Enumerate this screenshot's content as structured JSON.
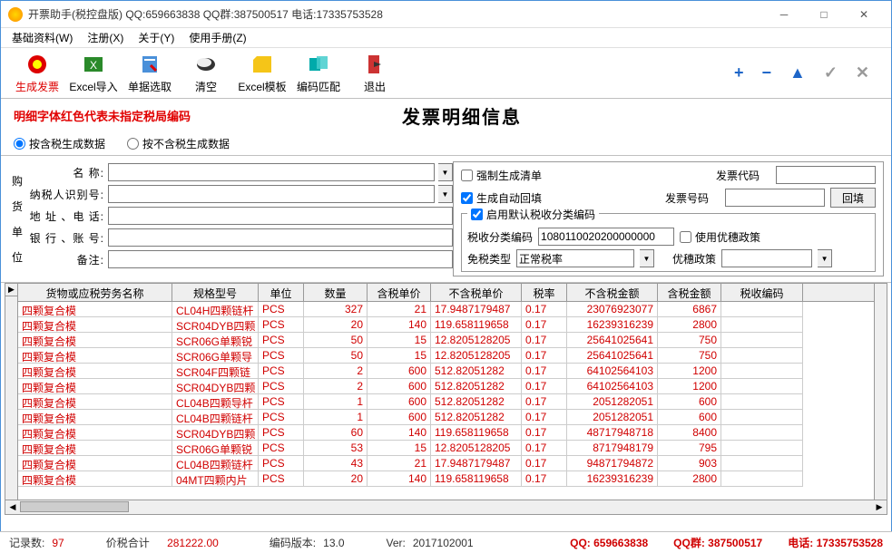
{
  "title": "开票助手(税控盘版)   QQ:659663838   QQ群:387500517   电话:17335753528",
  "menu": [
    "基础资料(W)",
    "注册(X)",
    "关于(Y)",
    "使用手册(Z)"
  ],
  "toolbar": [
    {
      "label": "生成发票",
      "color": "#d00"
    },
    {
      "label": "Excel导入",
      "color": "#090"
    },
    {
      "label": "单据选取",
      "color": "#06c"
    },
    {
      "label": "清空",
      "color": "#333"
    },
    {
      "label": "Excel模板",
      "color": "#e90"
    },
    {
      "label": "编码匹配",
      "color": "#099"
    },
    {
      "label": "退出",
      "color": "#c33"
    }
  ],
  "tb_right_colors": {
    "plus": "#1e66c8",
    "minus": "#1e66c8",
    "up": "#1e66c8",
    "check": "#8a8a8a",
    "x": "#8a8a8a"
  },
  "red_note": "明细字体红色代表未指定税局编码",
  "main_title": "发票明细信息",
  "radio": {
    "r1": "按含税生成数据",
    "r2": "按不含税生成数据"
  },
  "vlabel": [
    "购",
    "货",
    "单",
    "位"
  ],
  "form": {
    "name": "名          称:",
    "taxid": "纳税人识别号:",
    "addr": "地 址 、电 话:",
    "bank": "银 行 、账 号:",
    "remark": "备注:"
  },
  "fr": {
    "force": "强制生成清单",
    "autofill": "生成自动回填",
    "code_lbl": "发票代码",
    "num_lbl": "发票号码",
    "backfill_btn": "回填",
    "group_title": "启用默认税收分类编码",
    "taxclass_lbl": "税收分类编码",
    "taxclass_val": "1080110020200000000",
    "pref_lbl": "使用优穗政策",
    "exempt_lbl": "免税类型",
    "exempt_val": "正常税率",
    "pref2_lbl": "优穗政策"
  },
  "grid_headers": [
    "货物或应税劳务名称",
    "规格型号",
    "单位",
    "数量",
    "含税单价",
    "不含税单价",
    "税率",
    "不含税金额",
    "含税金额",
    "税收编码"
  ],
  "grid_rows": [
    [
      "四颗复合模",
      "CL04H四颗链杆",
      "PCS",
      "327",
      "21",
      "17.9487179487",
      "0.17",
      "23076923077",
      "6867",
      ""
    ],
    [
      "四颗复合模",
      "SCR04DYB四颗",
      "PCS",
      "20",
      "140",
      "119.658119658",
      "0.17",
      "16239316239",
      "2800",
      ""
    ],
    [
      "四颗复合模",
      "SCR06G单颗锐",
      "PCS",
      "50",
      "15",
      "12.8205128205",
      "0.17",
      "25641025641",
      "750",
      ""
    ],
    [
      "四颗复合模",
      "SCR06G单颗导",
      "PCS",
      "50",
      "15",
      "12.8205128205",
      "0.17",
      "25641025641",
      "750",
      ""
    ],
    [
      "四颗复合模",
      "SCR04F四颗链",
      "PCS",
      "2",
      "600",
      "512.82051282",
      "0.17",
      "64102564103",
      "1200",
      ""
    ],
    [
      "四颗复合模",
      "SCR04DYB四颗",
      "PCS",
      "2",
      "600",
      "512.82051282",
      "0.17",
      "64102564103",
      "1200",
      ""
    ],
    [
      "四颗复合模",
      "CL04B四颗导杆",
      "PCS",
      "1",
      "600",
      "512.82051282",
      "0.17",
      "2051282051",
      "600",
      ""
    ],
    [
      "四颗复合模",
      "CL04B四颗链杆",
      "PCS",
      "1",
      "600",
      "512.82051282",
      "0.17",
      "2051282051",
      "600",
      ""
    ],
    [
      "四颗复合模",
      "SCR04DYB四颗",
      "PCS",
      "60",
      "140",
      "119.658119658",
      "0.17",
      "48717948718",
      "8400",
      ""
    ],
    [
      "四颗复合模",
      "SCR06G单颗锐",
      "PCS",
      "53",
      "15",
      "12.8205128205",
      "0.17",
      "8717948179",
      "795",
      ""
    ],
    [
      "四颗复合模",
      "CL04B四颗链杆",
      "PCS",
      "43",
      "21",
      "17.9487179487",
      "0.17",
      "94871794872",
      "903",
      ""
    ],
    [
      "四颗复合模",
      "04MT四颗内片",
      "PCS",
      "20",
      "140",
      "119.658119658",
      "0.17",
      "16239316239",
      "2800",
      ""
    ]
  ],
  "status": {
    "rec_lbl": "记录数:",
    "rec_val": "97",
    "total_lbl": "价税合计",
    "total_val": "281222.00",
    "enc_lbl": "编码版本:",
    "enc_val": "13.0",
    "ver_lbl": "Ver:",
    "ver_val": "2017102001",
    "qq": "QQ: 659663838",
    "qqg": "QQ群: 387500517",
    "tel": "电话: 17335753528"
  }
}
